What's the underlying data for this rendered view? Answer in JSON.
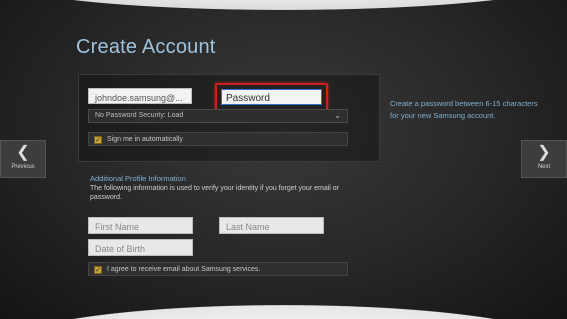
{
  "page": {
    "title": "Create Account"
  },
  "account": {
    "email_value": "johndoe.samsung@...",
    "password_placeholder": "Password",
    "security_select_value": "No Password Security: Load",
    "sign_in_auto_label": "Sign me in automatically"
  },
  "help_text": "Create a password between 6-15 characters for your new Samsung account.",
  "profile": {
    "section_title": "Additional Profile Information",
    "section_desc": "The following information is used to verify your identity if you forget your email or password.",
    "first_name_placeholder": "First Name",
    "last_name_placeholder": "Last Name",
    "dob_placeholder": "Date of Birth",
    "email_opt_in_label": "I agree to receive email about Samsung services."
  },
  "nav": {
    "prev_label": "Previous",
    "next_label": "Next"
  },
  "colors": {
    "highlight": "#d0201e",
    "accent_text": "#7fb0d3",
    "checkbox": "#c9a23a"
  }
}
